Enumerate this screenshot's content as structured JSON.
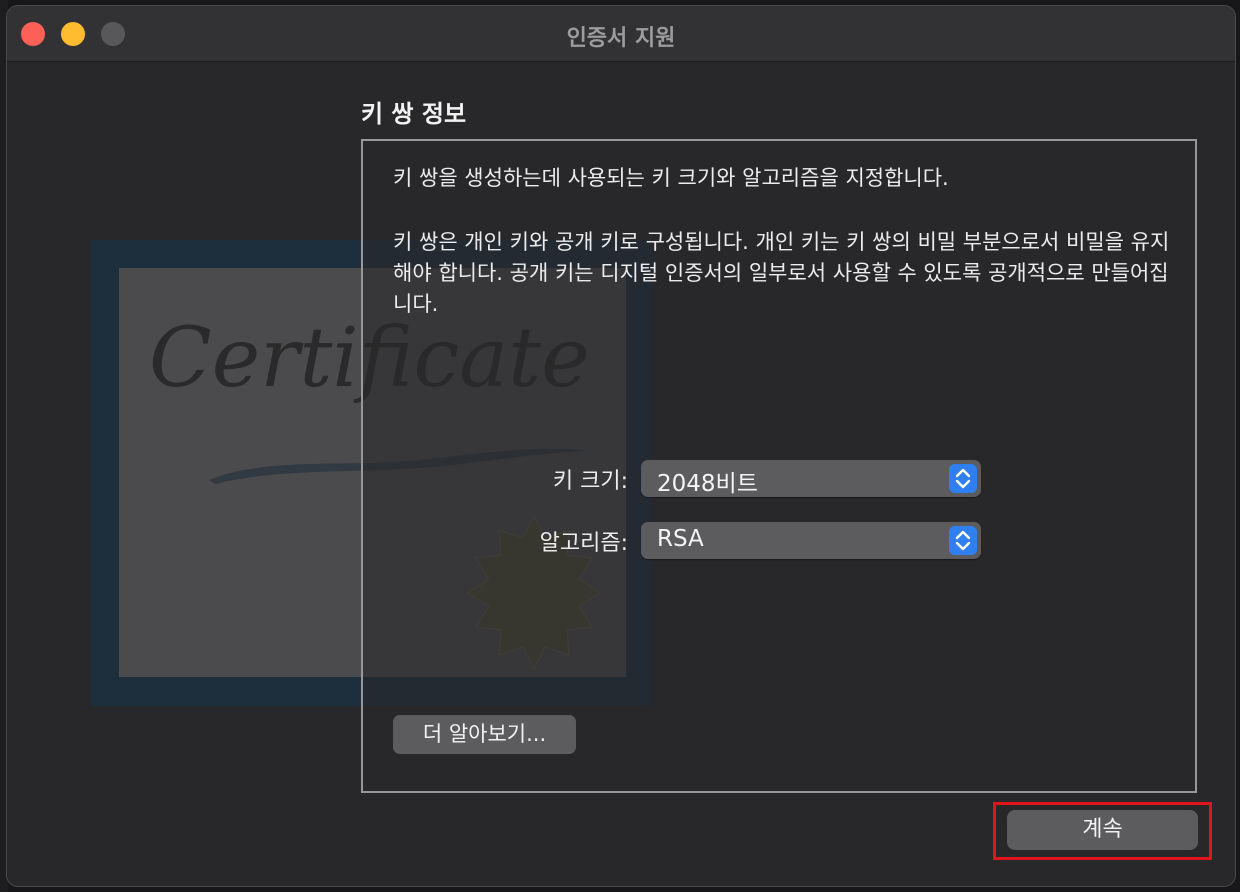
{
  "window": {
    "title": "인증서 지원"
  },
  "section": {
    "title": "키 쌍 정보"
  },
  "description": {
    "line1": "키 쌍을 생성하는데 사용되는 키 크기와 알고리즘을 지정합니다.",
    "line2": "키 쌍은 개인 키와 공개 키로 구성됩니다. 개인 키는 키 쌍의 비밀 부분으로서 비밀을 유지해야 합니다. 공개 키는 디지털 인증서의 일부로서 사용할 수 있도록 공개적으로 만들어집니다."
  },
  "fields": {
    "key_size": {
      "label": "키 크기:",
      "value": "2048비트"
    },
    "algorithm": {
      "label": "알고리즘:",
      "value": "RSA"
    }
  },
  "buttons": {
    "learn_more": "더 알아보기...",
    "continue": "계속"
  },
  "illustration": {
    "text": "Certificate"
  },
  "colors": {
    "accent": "#2f7ff1",
    "highlight": "#e0141a"
  }
}
